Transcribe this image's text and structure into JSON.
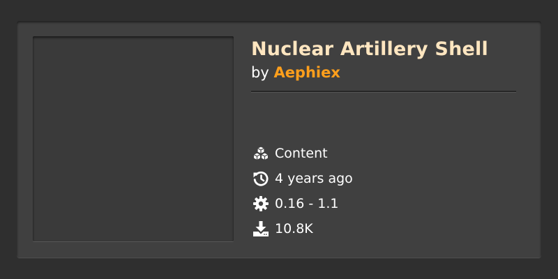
{
  "mod": {
    "title": "Nuclear Artillery Shell",
    "by_prefix": "by ",
    "author": "Aephiex"
  },
  "meta": {
    "category": {
      "icon": "cubes-icon",
      "label": "Content"
    },
    "updated": {
      "icon": "history-icon",
      "label": "4 years ago"
    },
    "version": {
      "icon": "gear-icon",
      "label": "0.16 - 1.1"
    },
    "downloads": {
      "icon": "download-icon",
      "label": "10.8K"
    }
  },
  "colors": {
    "title": "#ffe6c0",
    "author": "#ff9f1c",
    "card": "#404040",
    "frame": "#2f2f2f"
  }
}
